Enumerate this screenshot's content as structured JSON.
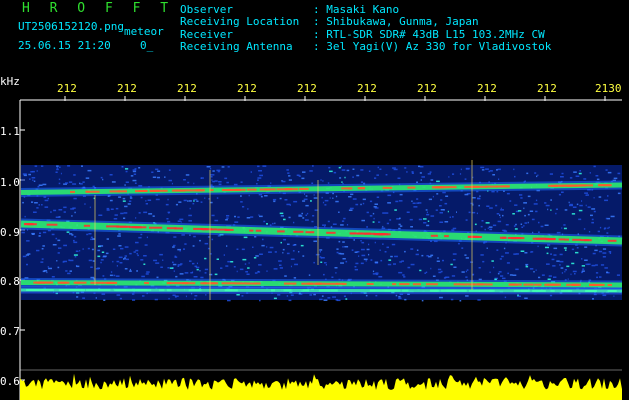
{
  "header": {
    "brand": "H R O F F T",
    "filename": "UT2506152120.png",
    "meteor_label": "meteor",
    "datetime": "25.06.15 21:20",
    "count": "0_",
    "info": [
      {
        "key": "Observer",
        "value": ": Masaki Kano"
      },
      {
        "key": "Receiving Location",
        "value": ": Shibukawa, Gunma, Japan"
      },
      {
        "key": "Receiver",
        "value": ": RTL-SDR SDR# 43dB L15 103.2MHz CW"
      },
      {
        "key": "Receiving Antenna",
        "value": ": 3el Yagi(V) Az 330 for Vladivostok"
      }
    ]
  },
  "colors": {
    "background": "#000000",
    "brand": "#2fe02f",
    "header_text": "#00e8ff",
    "x_labels": "#ffff40",
    "axis": "#ffffff",
    "signal_strong": "#ff3030",
    "signal_mid": "#30ff60",
    "noise": "#0a2fbf",
    "power_trace": "#ffff00"
  },
  "chart_data": {
    "type": "heatmap",
    "ylabel": "kHz",
    "y_ticks": [
      "1.1",
      "1.0",
      "0.9",
      "0.8",
      "0.7",
      "0.6"
    ],
    "ylim": [
      0.6,
      1.15
    ],
    "x_ticks": [
      "212",
      "212",
      "212",
      "212",
      "212",
      "212",
      "212",
      "212",
      "212",
      "2130"
    ],
    "bands": [
      {
        "freq_start": 0.912,
        "freq_end": 0.878,
        "intensity": "strong"
      },
      {
        "freq_start": 0.975,
        "freq_end": 0.99,
        "intensity": "medium"
      },
      {
        "freq_start": 0.795,
        "freq_end": 0.79,
        "intensity": "medium"
      },
      {
        "freq_start": 0.78,
        "freq_end": 0.778,
        "intensity": "weak"
      }
    ],
    "noise_band_khz": [
      0.76,
      1.03
    ],
    "grid": false,
    "legend": "none"
  }
}
